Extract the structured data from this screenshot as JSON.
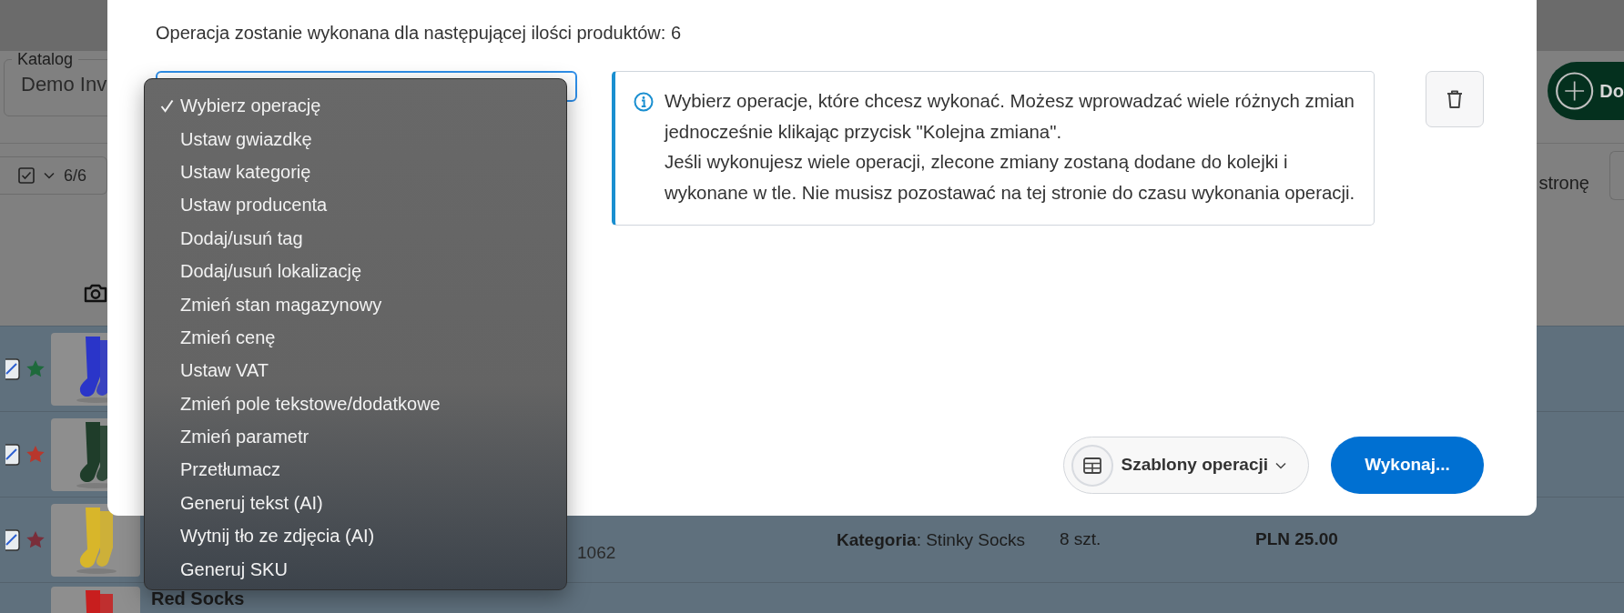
{
  "page": {
    "catalog": {
      "label": "Katalog",
      "value": "Demo Inv"
    },
    "add_button": {
      "label": "Do"
    },
    "selection": {
      "checked": true,
      "count": "6/6"
    },
    "pagination": {
      "label": "stronę"
    },
    "rows": [
      {
        "selected": true,
        "checked": true,
        "star": {
          "color": "#1e6a3c"
        }
      },
      {
        "selected": true,
        "checked": true,
        "star": {
          "color": "#b8372c"
        }
      },
      {
        "selected": true,
        "checked": true,
        "star": {
          "color": "#7a2e3a"
        },
        "code": "1062",
        "category": "**Kategoria**: Stinky Socks",
        "stock": "8 szt.",
        "price": "PLN 25.00"
      },
      {
        "selected": true,
        "name": "Red Socks"
      }
    ]
  },
  "modal": {
    "summary": "Operacja zostanie wykonana dla następującej ilości produktów: 6",
    "operation_select": {
      "options": [
        {
          "label": "Wybierz operację",
          "selected": true
        },
        {
          "label": "Ustaw gwiazdkę",
          "selected": false
        },
        {
          "label": "Ustaw kategorię",
          "selected": false
        },
        {
          "label": "Ustaw producenta",
          "selected": false
        },
        {
          "label": "Dodaj/usuń tag",
          "selected": false
        },
        {
          "label": "Dodaj/usuń lokalizację",
          "selected": false
        },
        {
          "label": "Zmień stan magazynowy",
          "selected": false
        },
        {
          "label": "Zmień cenę",
          "selected": false
        },
        {
          "label": "Ustaw VAT",
          "selected": false
        },
        {
          "label": "Zmień pole tekstowe/dodatkowe",
          "selected": false
        },
        {
          "label": "Zmień parametr",
          "selected": false
        },
        {
          "label": "Przetłumacz",
          "selected": false
        },
        {
          "label": "Generuj tekst (AI)",
          "selected": false
        },
        {
          "label": "Wytnij tło ze zdjęcia (AI)",
          "selected": false
        },
        {
          "label": "Generuj SKU",
          "selected": false
        }
      ]
    },
    "info": [
      "Wybierz operacje, które chcesz wykonać. Możesz wprowadzać wiele różnych zmian jednocześnie klikając przycisk \"Kolejna zmiana\".",
      "Jeśli wykonujesz wiele operacji, zlecone zmiany zostaną dodane do kolejki i wykonane w tle. Nie musisz pozostawać na tej stronie do czasu wykonania operacji."
    ],
    "templates_button": "Szablony operacji",
    "execute_button": "Wykonaj..."
  }
}
